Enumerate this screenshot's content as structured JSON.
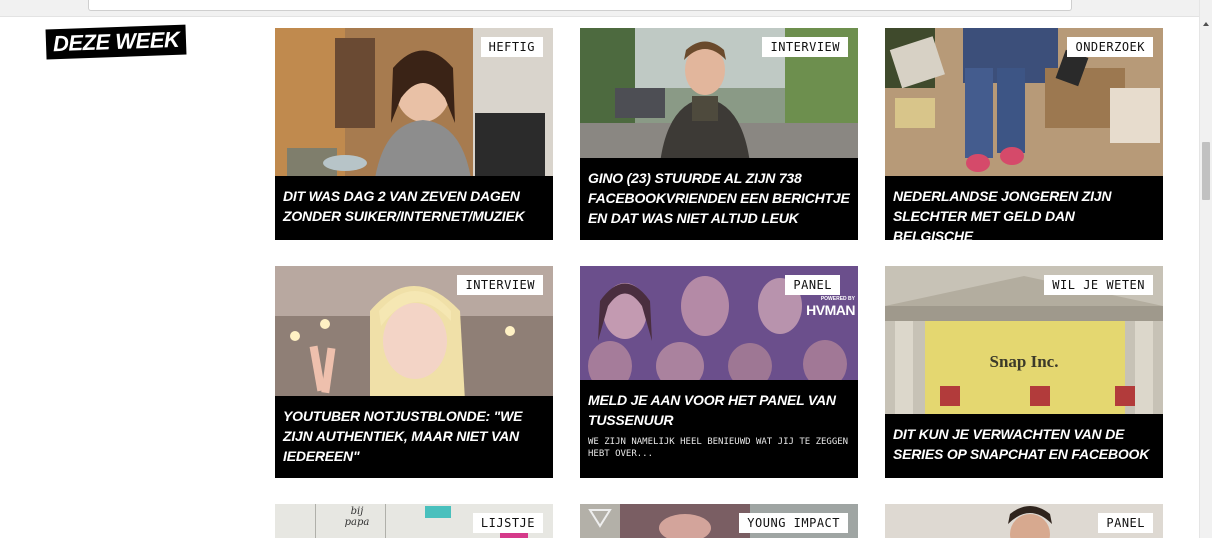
{
  "section_title": "DEZE WEEK",
  "cards": [
    {
      "tag": "HEFTIG",
      "headline": "DIT WAS DAG 2 VAN ZEVEN DAGEN ZONDER SUIKER/INTERNET/MUZIEK",
      "sub": ""
    },
    {
      "tag": "INTERVIEW",
      "headline": "GINO (23) STUURDE AL ZIJN 738 FACEBOOKVRIENDEN EEN BERICHTJE EN DAT WAS NIET ALTIJD LEUK",
      "sub": ""
    },
    {
      "tag": "ONDERZOEK",
      "headline": "NEDERLANDSE JONGEREN ZIJN SLECHTER MET GELD DAN BELGISCHE",
      "sub": ""
    },
    {
      "tag": "INTERVIEW",
      "headline": "YOUTUBER NOTJUSTBLONDE: \"WE ZIJN AUTHENTIEK, MAAR NIET VAN IEDEREEN\"",
      "sub": ""
    },
    {
      "tag": "PANEL",
      "headline": "MELD JE AAN VOOR HET PANEL VAN TUSSENUUR",
      "sub": "WE ZIJN NAMELIJK HEEL BENIEUWD WAT JIJ TE ZEGGEN HEBT OVER...",
      "sponsor_small": "POWERED BY",
      "sponsor_brand": "HVMAN"
    },
    {
      "tag": "WIL JE WETEN",
      "headline": "DIT KUN JE VERWACHTEN VAN DE SERIES OP SNAPCHAT EN FACEBOOK",
      "sub": "",
      "banner_text": "Snap Inc."
    },
    {
      "tag": "LIJSTJE",
      "headline": "",
      "sub": "",
      "image_text": "bij papa"
    },
    {
      "tag": "YOUNG IMPACT",
      "headline": "",
      "sub": ""
    },
    {
      "tag": "PANEL",
      "headline": "",
      "sub": ""
    }
  ]
}
